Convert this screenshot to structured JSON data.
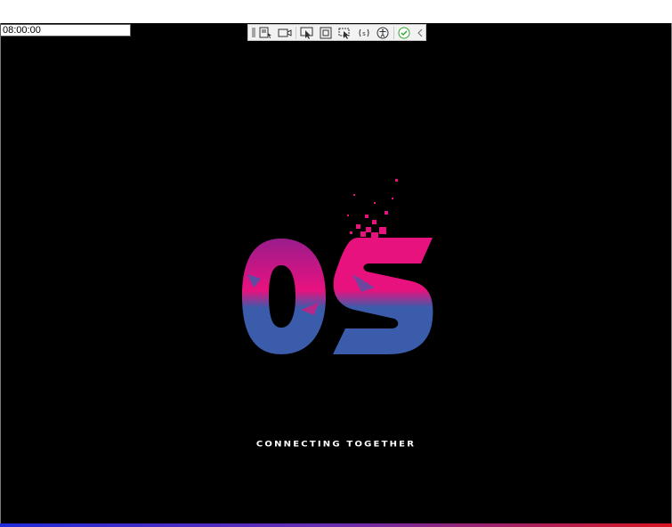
{
  "time_display": "08:00:00",
  "toolbar": {
    "buttons": [
      {
        "name": "select-display-icon",
        "title": ""
      },
      {
        "name": "camera-icon",
        "title": ""
      },
      {
        "name": "pointer-icon",
        "title": ""
      },
      {
        "name": "fullscreen-icon",
        "title": ""
      },
      {
        "name": "capture-region-icon",
        "title": ""
      },
      {
        "name": "audio-icon",
        "title": ""
      },
      {
        "name": "accessibility-icon",
        "title": ""
      },
      {
        "name": "check-icon",
        "title": ""
      },
      {
        "name": "collapse-icon",
        "title": ""
      }
    ]
  },
  "logo": {
    "text": "OS"
  },
  "tagline": "CONNECTING TOGETHER",
  "colors": {
    "background": "#000000",
    "logo_pink": "#e8127f",
    "logo_blue": "#3a5cab",
    "check_green": "#2fa82f"
  }
}
